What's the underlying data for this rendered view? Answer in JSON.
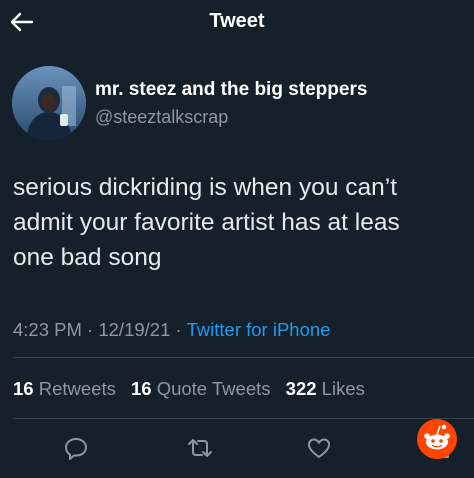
{
  "header": {
    "title": "Tweet",
    "back_icon": "arrow-left-icon"
  },
  "author": {
    "display_name": "mr. steez and the big steppers",
    "handle": "@steeztalkscrap"
  },
  "tweet": {
    "lines": [
      "serious dickriding is when you can’t",
      "admit your favorite artist has at leas",
      "one bad song"
    ]
  },
  "meta": {
    "time": "4:23 PM",
    "sep1": "·",
    "date": "12/19/21",
    "sep2": "·",
    "source": "Twitter for iPhone"
  },
  "stats": {
    "retweets_count": "16",
    "retweets_label": "Retweets",
    "quote_count": "16",
    "quote_label": "Quote Tweets",
    "likes_count": "322",
    "likes_label": "Likes"
  },
  "actions": {
    "reply_icon": "reply-icon",
    "retweet_icon": "retweet-icon",
    "like_icon": "heart-icon",
    "share_icon": "share-icon"
  },
  "colors": {
    "background": "#15202b",
    "text": "#e7e9ea",
    "muted": "#8b98a5",
    "accent": "#1d9bf0",
    "divider": "#38444d",
    "reddit_orange": "#ff4500"
  }
}
